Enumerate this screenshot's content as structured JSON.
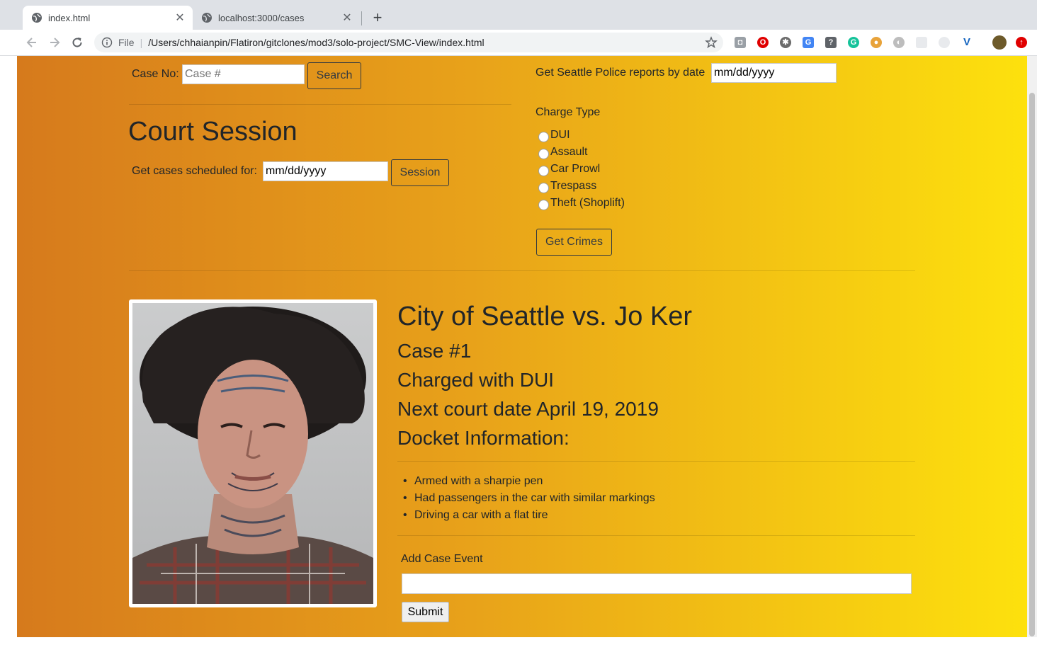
{
  "browser": {
    "tabs": [
      {
        "title": "index.html",
        "active": true
      },
      {
        "title": "localhost:3000/cases",
        "active": false
      }
    ],
    "address": {
      "scheme_label": "File",
      "url": "/Users/chhaianpin/Flatiron/gitclones/mod3/solo-project/SMC-View/index.html"
    },
    "extensions": [
      "camera-icon",
      "opera-icon",
      "settings-wheel-icon",
      "google-translate-icon",
      "question-icon",
      "grammarly-icon",
      "cookie-icon",
      "shield-icon",
      "blank-extension-icon",
      "timer-icon",
      "vue-icon",
      "avatar-icon",
      "red-alert-icon"
    ]
  },
  "search": {
    "label": "Case No:",
    "placeholder": "Case #",
    "button": "Search"
  },
  "session": {
    "title": "Court Session",
    "label": "Get cases scheduled for:",
    "date_value": "mm/dd/yyyy",
    "button": "Session"
  },
  "police": {
    "label": "Get Seattle Police reports by date",
    "date_value": "mm/dd/yyyy",
    "charge_label": "Charge Type",
    "charges": [
      "DUI",
      "Assault",
      "Car Prowl",
      "Trespass",
      "Theft (Shoplift)"
    ],
    "button": "Get Crimes"
  },
  "case": {
    "title": "City of Seattle vs. Jo Ker",
    "number": "Case #1",
    "charge": "Charged with DUI",
    "next_date": "Next court date April 19, 2019",
    "docket_heading": "Docket Information:",
    "docket": [
      "Armed with a sharpie pen",
      "Had passengers in the car with similar markings",
      "Driving a car with a flat tire"
    ],
    "event_label": "Add Case Event",
    "event_value": "",
    "submit": "Submit"
  },
  "colors": {
    "gradient_start": "#d67a1c",
    "gradient_end": "#fde10d"
  }
}
